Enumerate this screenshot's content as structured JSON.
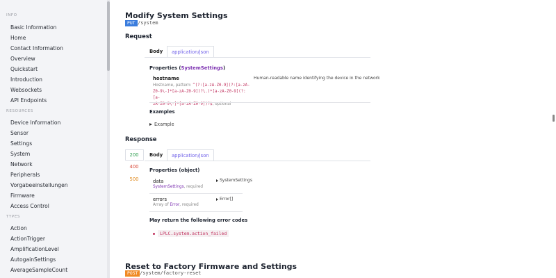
{
  "sidebar": {
    "sections": {
      "info": "INFO",
      "resources": "RESOURCES",
      "types": "TYPES"
    },
    "info_items": [
      "Basic Information",
      "Home",
      "Contact Information",
      "Overview",
      "Quickstart",
      "Introduction",
      "Websockets",
      "API Endpoints"
    ],
    "resource_items": [
      "Device Information",
      "Sensor",
      "Settings",
      "System",
      "Network",
      "Peripherals",
      "Vorgabeeinstellungen",
      "Firmware",
      "Access Control"
    ],
    "type_items": [
      "Action",
      "ActionTrigger",
      "AmplificationLevel",
      "AutogainSettings",
      "AverageSampleCount"
    ]
  },
  "endpoint": {
    "title": "Modify System Settings",
    "method": "PUT",
    "path": "/system",
    "method_color": "#3b7ddd"
  },
  "request": {
    "heading": "Request",
    "tab_body": "Body",
    "tab_json": "application/json",
    "properties_prefix": "Properties (",
    "properties_link": "SystemSettings",
    "properties_suffix": ")",
    "prop_name": "hostname",
    "prop_hint": "Hostname, pattern:",
    "pattern_line1": "^(?:[a-zA-Z0-9](?:[a-zA-",
    "pattern_line2": "Z0-9\\-]*[a-zA-Z0-9])?\\.)*[a-zA-Z0-9](?:[a-",
    "pattern_line3": "zA-Z0-9\\-]*[a-zA-Z0-9])?$",
    "optional": ", optional",
    "prop_desc": "Human-readable name identifying the device in the network",
    "examples_heading": "Examples",
    "example_toggle": "Example"
  },
  "response": {
    "heading": "Response",
    "codes": [
      "200",
      "400",
      "500"
    ],
    "code_colors": [
      "#2e9e4f",
      "#d94a3a",
      "#e08a1e"
    ],
    "tab_body": "Body",
    "tab_json": "application/json",
    "properties_label": "Properties (object)",
    "data_name": "data",
    "data_type_link": "SystemSettings",
    "data_required": ", required",
    "data_toggle": "SystemSettings",
    "errors_name": "errors",
    "errors_prefix": "Array of ",
    "errors_link": "Error",
    "errors_required": ", required",
    "errors_toggle": "Error[]",
    "error_codes_heading": "May return the following error codes",
    "error_code": "LPLC.system.action_failed"
  },
  "next_endpoint": {
    "title": "Reset to Factory Firmware and Settings",
    "method": "POST",
    "path": "/system/factory-reset",
    "method_color": "#f08a24"
  }
}
